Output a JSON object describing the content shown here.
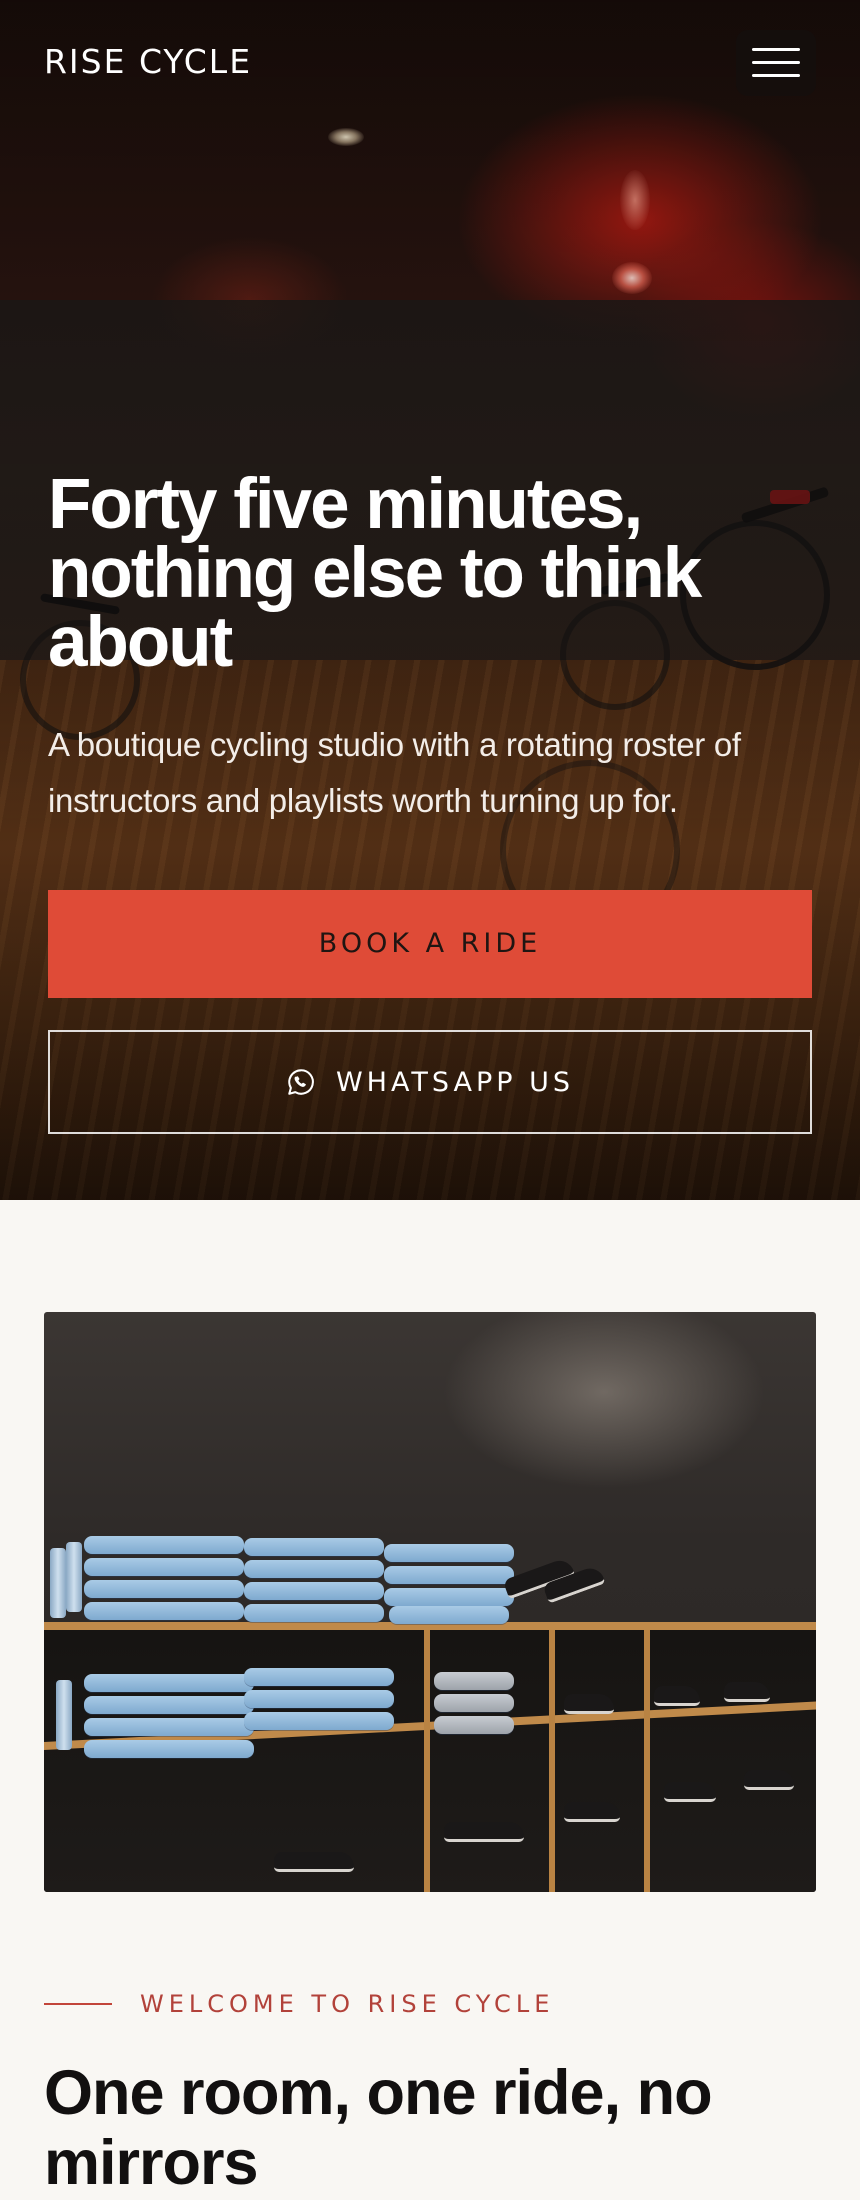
{
  "header": {
    "brand": "RISE CYCLE",
    "menu_icon": "hamburger-menu-icon"
  },
  "hero": {
    "title": "Forty five minutes, nothing else to think about",
    "subtitle": "A boutique cycling studio with a rotating roster of instructors and playlists worth turning up for.",
    "primary_cta": "BOOK A RIDE",
    "secondary_cta": "WHATSAPP US",
    "secondary_cta_icon": "whatsapp-icon"
  },
  "welcome": {
    "eyebrow": "WELCOME TO RISE CYCLE",
    "title": "One room, one ride, no mirrors"
  },
  "colors": {
    "accent": "#df4b37",
    "eyebrow": "#b2423a",
    "page_bg": "#f9f7f3",
    "heading": "#121010"
  }
}
